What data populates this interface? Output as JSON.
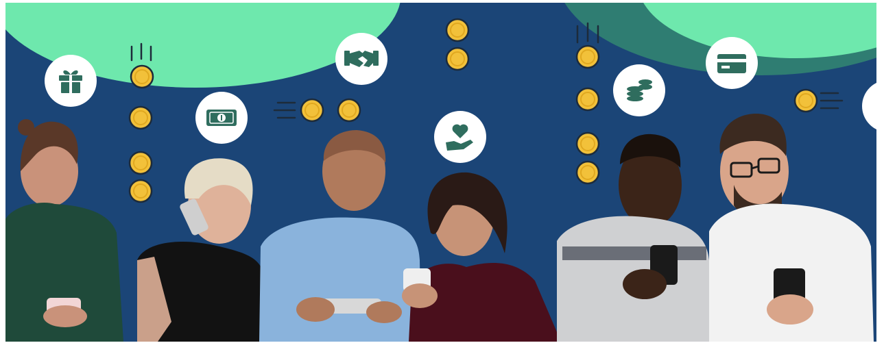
{
  "scene": {
    "description_colors": {
      "frame": "#ffffff",
      "background": "#1b4577",
      "mint": "#6ee8ad",
      "teal_dark": "#2f7d72",
      "coin_fill": "#f2c13a",
      "coin_ring": "#1d2b3a",
      "badge_fill": "#ffffff",
      "icon_color": "#2f6d5e"
    },
    "icons": [
      "gift-icon",
      "banknote-icon",
      "handshake-icon",
      "coins-stack-icon",
      "credit-card-icon",
      "heart-in-hand-icon"
    ],
    "people": [
      "woman-green-top",
      "woman-black-top-phone-call",
      "man-blue-shirt-earphones",
      "woman-velvet-top",
      "man-knit-sweater",
      "man-glasses-white-shirt"
    ]
  }
}
